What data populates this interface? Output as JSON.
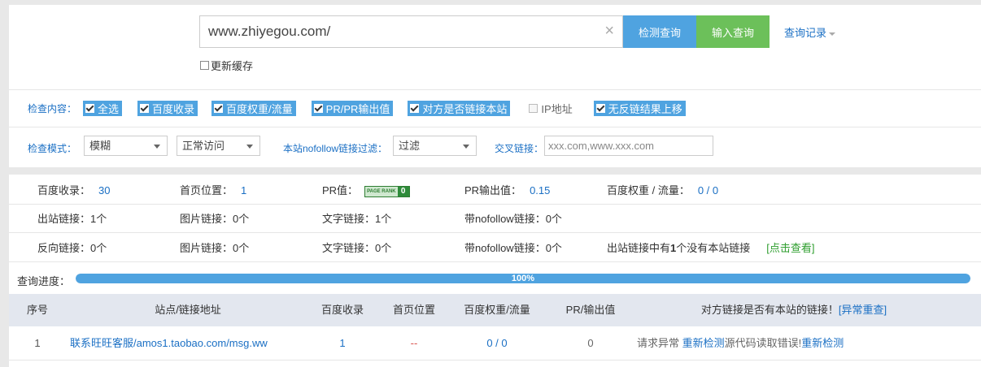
{
  "search": {
    "url_value": "www.zhiyegou.com/",
    "detect_label": "检测查询",
    "input_label": "输入查询",
    "history_label": "查询记录",
    "cache_label": "更新缓存"
  },
  "check_content": {
    "label": "检查内容：",
    "options": [
      {
        "label": "全选",
        "checked": true
      },
      {
        "label": "百度收录",
        "checked": true
      },
      {
        "label": "百度权重/流量",
        "checked": true
      },
      {
        "label": "PR/PR输出值",
        "checked": true
      },
      {
        "label": "对方是否链接本站",
        "checked": true
      },
      {
        "label": "IP地址",
        "checked": false
      },
      {
        "label": "无反链结果上移",
        "checked": true
      }
    ]
  },
  "check_mode": {
    "label": "检查模式：",
    "mode_value": "模糊",
    "access_value": "正常访问",
    "nofollow_label": "本站nofollow链接过滤：",
    "nofollow_value": "过滤",
    "cross_label": "交叉链接：",
    "cross_placeholder": "xxx.com,www.xxx.com"
  },
  "stats": {
    "baidu_index_label": "百度收录：",
    "baidu_index_value": "30",
    "home_pos_label": "首页位置：",
    "home_pos_value": "1",
    "pr_label": "PR值：",
    "pr_badge_text": "PAGE RANK",
    "pr_value": "0",
    "pr_out_label": "PR输出值：",
    "pr_out_value": "0.15",
    "weight_label": "百度权重 / 流量：",
    "weight_value": "0 / 0",
    "outbound_label": "出站链接：",
    "outbound_value": "1个",
    "img_link_label": "图片链接：",
    "img_link_value": "0个",
    "text_link_label": "文字链接：",
    "text_link_value": "1个",
    "nofollow_link_label": "带nofollow链接：",
    "nofollow_link_value": "0个",
    "back_label": "反向链接：",
    "back_value": "0个",
    "img_link2_value": "0个",
    "text_link2_value": "0个",
    "nofollow_link2_value": "0个",
    "note_prefix": "出站链接中有",
    "note_count": "1",
    "note_suffix": "个没有本站链接",
    "view_link": "[点击查看]"
  },
  "progress": {
    "label": "查询进度：",
    "percent_text": "100%",
    "value": 1.0
  },
  "table": {
    "headers": {
      "index": "序号",
      "site": "站点/链接地址",
      "baidu": "百度收录",
      "home": "首页位置",
      "weight": "百度权重/流量",
      "pr": "PR/输出值",
      "linkback": "对方链接是否有本站的链接！",
      "retry": "[异常重查]"
    },
    "rows": [
      {
        "index": "1",
        "site_name": "联系旺旺客服",
        "site_url": "/amos1.taobao.com/msg.ww",
        "baidu": "1",
        "home": "--",
        "weight": "0 / 0",
        "pr": "0",
        "status_prefix": "请求异常",
        "recheck1": "重新检测",
        "status_middle": "源代码读取错误",
        "recheck2": "重新检测"
      }
    ]
  }
}
